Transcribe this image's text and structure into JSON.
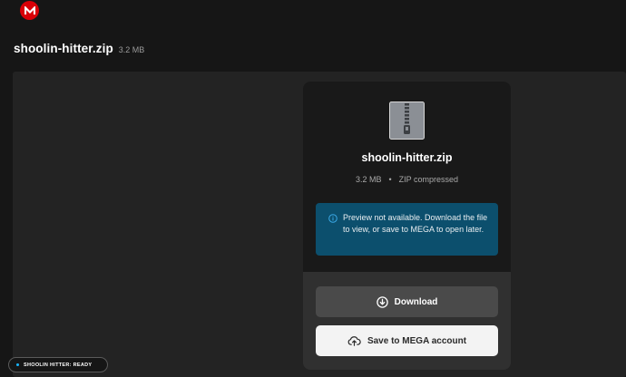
{
  "brand": {
    "logo_letter": "M",
    "logo_color": "#d90007"
  },
  "header": {
    "file_name": "shoolin-hitter.zip",
    "file_size": "3.2 MB"
  },
  "card": {
    "icon": "zip-file-icon",
    "file_name": "shoolin-hitter.zip",
    "size": "3.2 MB",
    "separator": "•",
    "type": "ZIP compressed",
    "info_icon": "info-circle-icon",
    "info_message": "Preview not available. Download the file to view, or save to MEGA to open later.",
    "info_color": "#0c4f6d"
  },
  "actions": {
    "download_label": "Download",
    "download_icon": "download-circle-icon",
    "save_label": "Save to MEGA account",
    "save_icon": "cloud-upload-icon"
  },
  "status": {
    "text": "SHOOLIN HITTER: READY",
    "dot_color": "#16b6ff"
  }
}
